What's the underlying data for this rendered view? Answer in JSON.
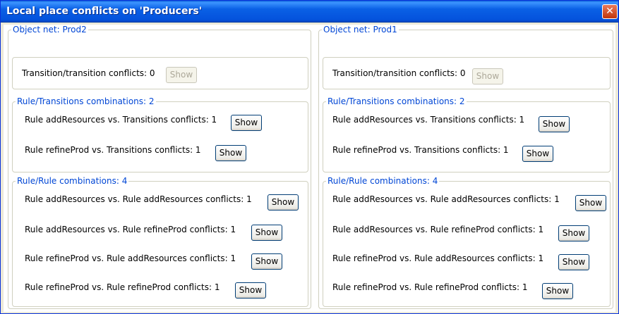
{
  "window": {
    "title": "Local place conflicts on 'Producers'"
  },
  "left": {
    "object_net": "Object net: Prod2",
    "tt_label": "Transition/transition conflicts: 0",
    "rule_trans_header": "Rule/Transitions combinations: 2",
    "rule_trans": [
      "Rule addResources vs. Transitions conflicts: 1",
      "Rule refineProd vs. Transitions conflicts: 1"
    ],
    "rule_rule_header": "Rule/Rule combinations: 4",
    "rule_rule": [
      "Rule addResources vs. Rule addResources conflicts: 1",
      "Rule addResources vs. Rule refineProd conflicts: 1",
      "Rule refineProd vs. Rule addResources conflicts: 1",
      "Rule refineProd vs. Rule refineProd conflicts: 1"
    ]
  },
  "right": {
    "object_net": "Object net: Prod1",
    "tt_label": "Transition/transition conflicts: 0",
    "rule_trans_header": "Rule/Transitions combinations: 2",
    "rule_trans": [
      "Rule addResources vs. Transitions conflicts: 1",
      "Rule refineProd vs. Transitions conflicts: 1"
    ],
    "rule_rule_header": "Rule/Rule combinations: 4",
    "rule_rule": [
      "Rule addResources vs. Rule addResources conflicts: 1",
      "Rule addResources vs. Rule refineProd conflicts: 1",
      "Rule refineProd vs. Rule addResources conflicts: 1",
      "Rule refineProd vs. Rule refineProd conflicts: 1"
    ]
  },
  "show_label": "Show",
  "close_glyph": "✕",
  "colors": {
    "title_bar": "#0a5fd8",
    "group_header": "#0046d5",
    "close_button": "#c2350b"
  }
}
